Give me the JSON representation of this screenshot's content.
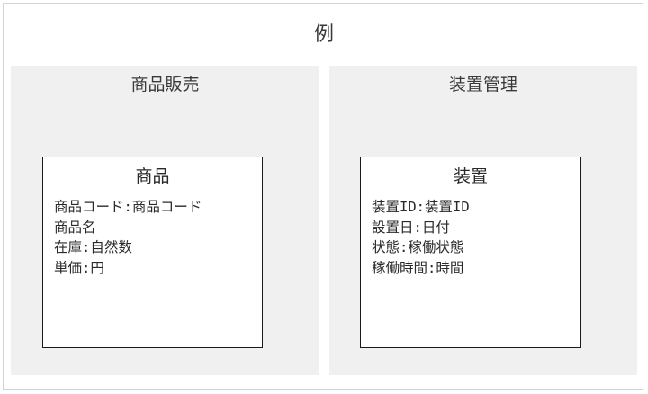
{
  "title": "例",
  "contexts": [
    {
      "label": "商品販売",
      "entity": {
        "name": "商品",
        "attributes": [
          "商品コード:商品コード",
          "商品名",
          "在庫:自然数",
          "単価:円"
        ]
      }
    },
    {
      "label": "装置管理",
      "entity": {
        "name": "装置",
        "attributes": [
          "装置ID:装置ID",
          "設置日:日付",
          "状態:稼働状態",
          "稼働時間:時間"
        ]
      }
    }
  ]
}
